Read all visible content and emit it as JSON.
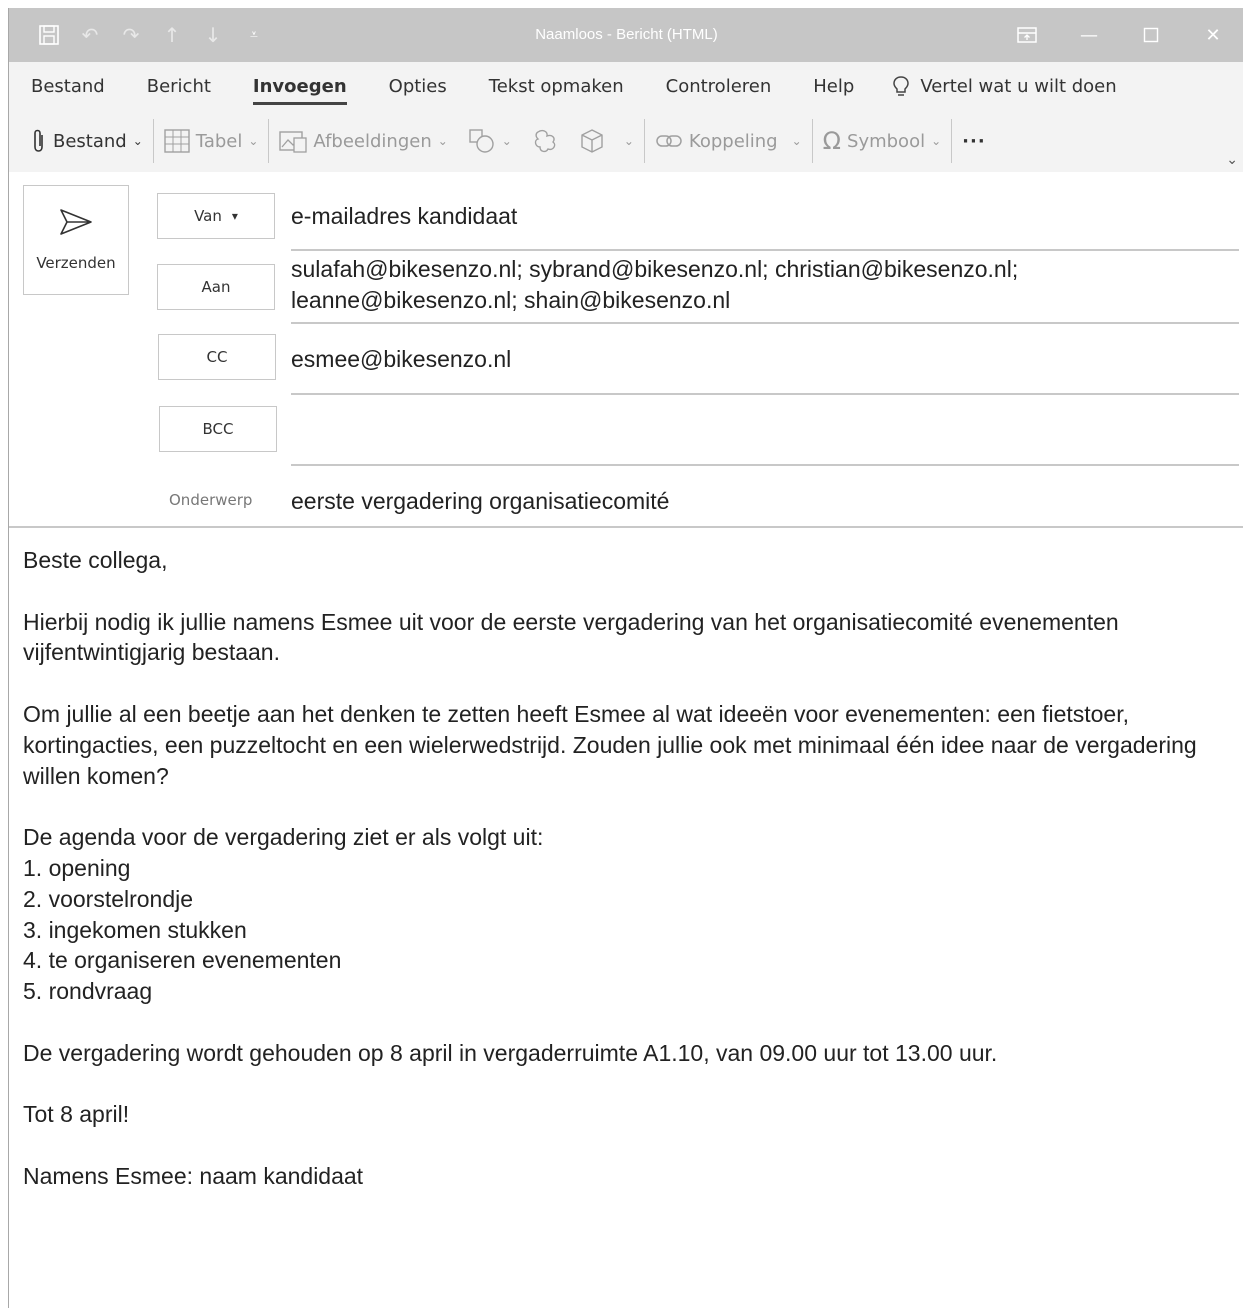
{
  "window": {
    "title": "Naamloos - Bericht (HTML)",
    "quick_access": [
      "save-icon",
      "undo-icon",
      "redo-icon",
      "arrow-up-icon",
      "arrow-down-icon",
      "customize-icon"
    ],
    "controls": [
      "ribbon-display-icon",
      "minimize-icon",
      "maximize-icon",
      "close-icon"
    ]
  },
  "ribbon_tabs": {
    "items": [
      {
        "label": "Bestand"
      },
      {
        "label": "Bericht"
      },
      {
        "label": "Invoegen"
      },
      {
        "label": "Opties"
      },
      {
        "label": "Tekst opmaken"
      },
      {
        "label": "Controleren"
      },
      {
        "label": "Help"
      }
    ],
    "active": "Invoegen",
    "tell_me": "Vertel wat u wilt doen"
  },
  "ribbon": {
    "attach_label": "Bestand",
    "table_label": "Tabel",
    "pictures_label": "Afbeeldingen",
    "link_label": "Koppeling",
    "symbol_label": "Symbool",
    "more_label": "···"
  },
  "compose": {
    "send_label": "Verzenden",
    "from_label": "Van",
    "from_value": "e-mailadres kandidaat",
    "to_label": "Aan",
    "to_line1": "sulafah@bikesenzo.nl; sybrand@bikesenzo.nl; christian@bikesenzo.nl;",
    "to_line2": "leanne@bikesenzo.nl; shain@bikesenzo.nl",
    "cc_label": "CC",
    "cc_value": "esmee@bikesenzo.nl",
    "bcc_label": "BCC",
    "bcc_value": "",
    "subject_label": "Onderwerp",
    "subject_value": "eerste vergadering organisatiecomité"
  },
  "message": {
    "greeting": "Beste collega,",
    "p1": "Hierbij nodig ik jullie namens Esmee uit voor de eerste vergadering van het organisatiecomité evenementen vijfentwintigjarig bestaan.",
    "p2": "Om jullie al een beetje aan het denken te zetten heeft Esmee al wat ideeën voor evenementen: een fietstoer, kortingacties, een puzzeltocht en een wielerwedstrijd. Zouden jullie ook met minimaal één idee naar de vergadering willen komen?",
    "agenda_intro": "De agenda voor de vergadering ziet er als volgt uit:",
    "agenda": [
      "1. opening",
      "2. voorstelrondje",
      "3. ingekomen stukken",
      "4. te organiseren evenementen",
      "5. rondvraag"
    ],
    "p3": "De vergadering wordt gehouden op 8 april in vergaderruimte A1.10, van 09.00 uur tot 13.00 uur.",
    "closing": "Tot 8 april!",
    "signature": "Namens Esmee: naam kandidaat"
  }
}
